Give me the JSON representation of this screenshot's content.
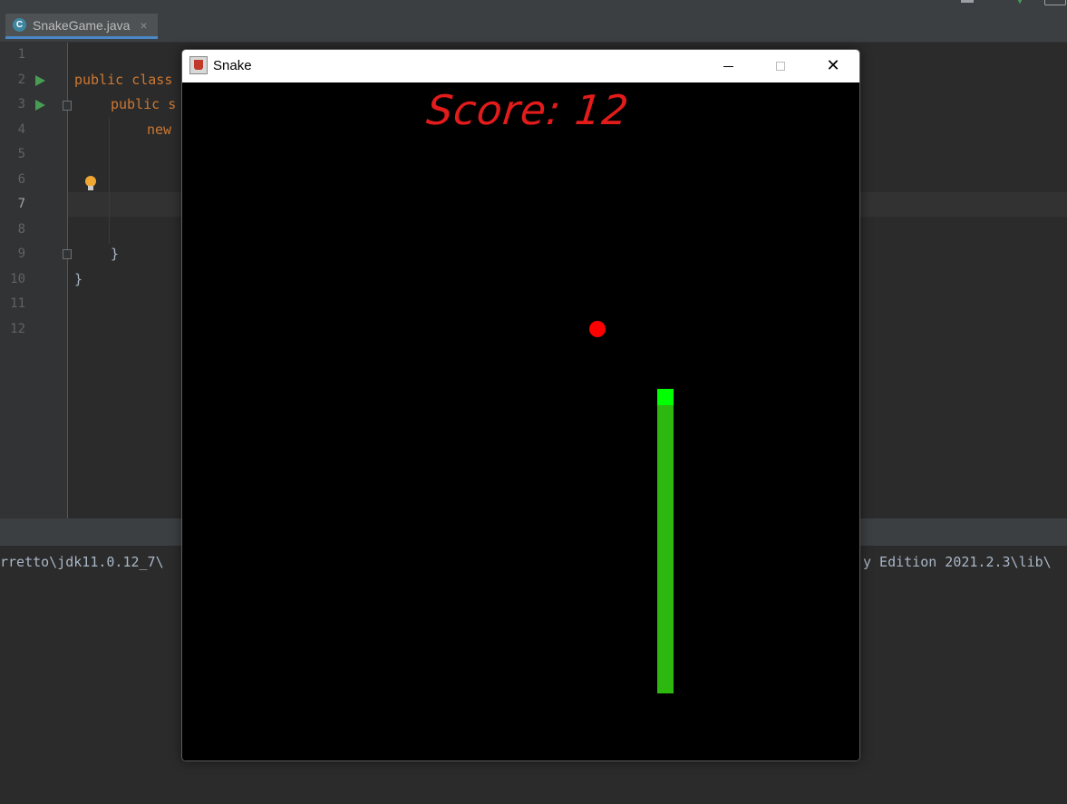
{
  "ide": {
    "tab": {
      "label": "SnakeGame.java",
      "icon": "class-c-icon",
      "close": "×"
    },
    "line_numbers": [
      "1",
      "2",
      "3",
      "4",
      "5",
      "6",
      "7",
      "8",
      "9",
      "10",
      "11",
      "12"
    ],
    "code_lines": {
      "l2": "public class",
      "l3": "public s",
      "l4": "new",
      "l9": "}",
      "l10": "}"
    },
    "console": {
      "left_text": "rretto\\jdk11.0.12_7\\",
      "right_text": "y Edition 2021.2.3\\lib\\"
    },
    "colors": {
      "keyword": "#cc7832",
      "text": "#a9b7c6",
      "background": "#2b2b2b"
    }
  },
  "snake_window": {
    "title": "Snake",
    "buttons": {
      "minimize": "minimize",
      "maximize": "maximize",
      "close": "✕"
    },
    "score_text": "Score: 12",
    "colors": {
      "score": "#e31b1b",
      "food": "#ff0000",
      "snake_head": "#00ff00",
      "snake_body": "#2cb80e",
      "board": "#000000"
    }
  }
}
